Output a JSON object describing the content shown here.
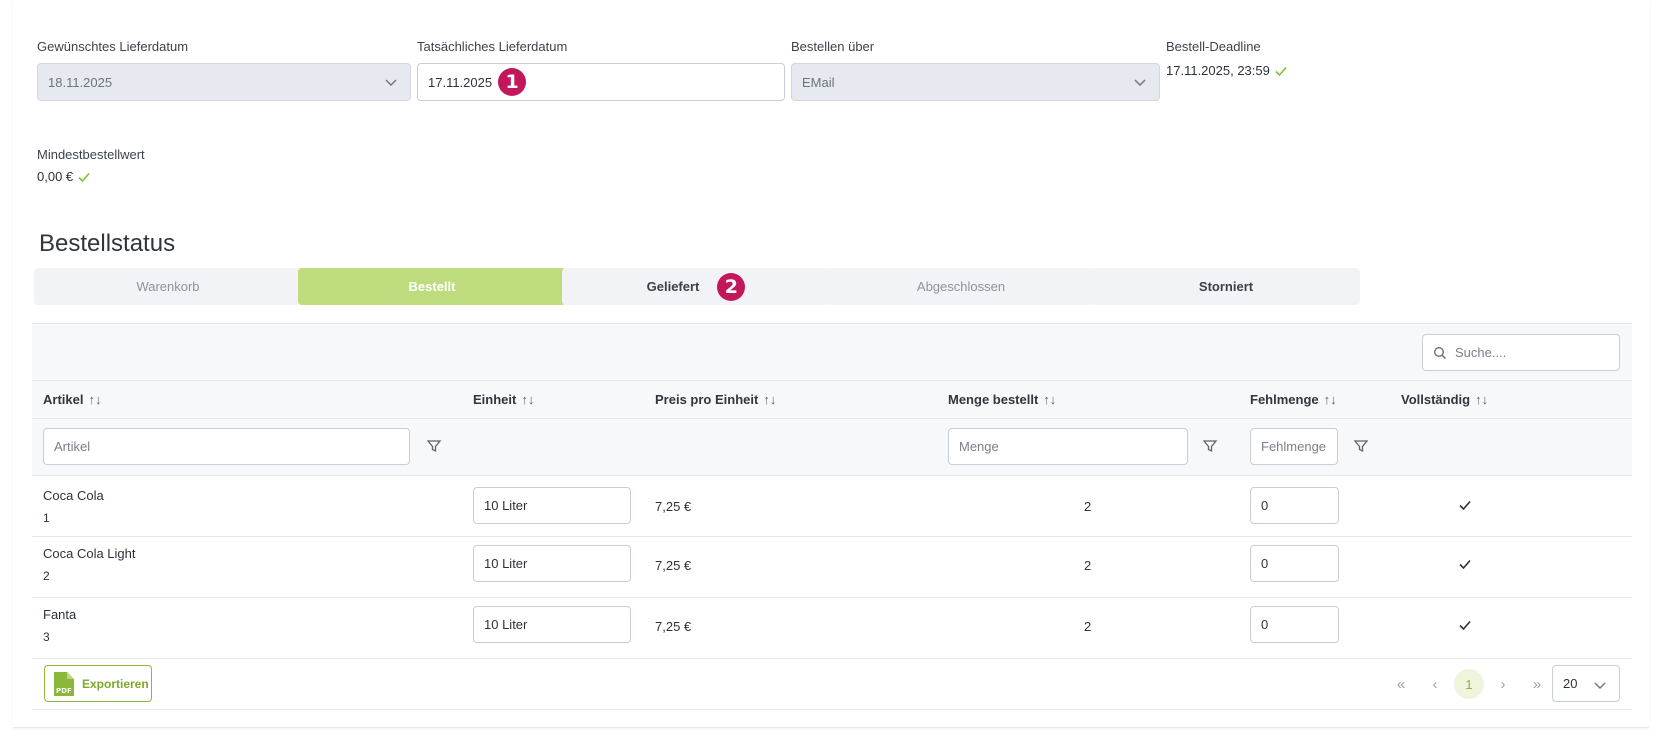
{
  "delivery": {
    "desired_label": "Gewünschtes Lieferdatum",
    "desired_value": "18.11.2025",
    "actual_label": "Tatsächliches Lieferdatum",
    "actual_value": "17.11.2025",
    "actual_badge": "1",
    "order_via_label": "Bestellen über",
    "order_via_value": "EMail",
    "deadline_label": "Bestell-Deadline",
    "deadline_value": "17.11.2025, 23:59",
    "min_label": "Mindestbestellwert",
    "min_value": "0,00 €"
  },
  "status": {
    "title": "Bestellstatus",
    "buttons": [
      {
        "label": "Warenkorb"
      },
      {
        "label": "Bestellt"
      },
      {
        "label": "Geliefert",
        "badge": "2"
      },
      {
        "label": "Abgeschlossen"
      },
      {
        "label": "Storniert"
      }
    ]
  },
  "table": {
    "search_placeholder": "Suche....",
    "sort_icon": "↑↓",
    "columns": [
      "Artikel",
      "Einheit",
      "Preis pro Einheit",
      "Menge bestellt",
      "Fehlmenge",
      "Vollständig"
    ],
    "filters": {
      "artikel_placeholder": "Artikel",
      "menge_placeholder": "Menge",
      "fehlmenge_placeholder": "Fehlmenge"
    },
    "rows": [
      {
        "name": "Coca Cola",
        "id": "1",
        "unit": "10 Liter",
        "price": "7,25 €",
        "qty": "2",
        "missing": "0"
      },
      {
        "name": "Coca Cola Light",
        "id": "2",
        "unit": "10 Liter",
        "price": "7,25 €",
        "qty": "2",
        "missing": "0"
      },
      {
        "name": "Fanta",
        "id": "3",
        "unit": "10 Liter",
        "price": "7,25 €",
        "qty": "2",
        "missing": "0"
      }
    ]
  },
  "footer": {
    "export_label": "Exportieren",
    "pdf_text": "PDF",
    "pager": {
      "first": "«",
      "prev": "‹",
      "current": "1",
      "next": "›",
      "last": "»"
    },
    "page_size": "20"
  },
  "colors": {
    "accent_green": "#bedb7e",
    "badge_magenta": "#c2185b"
  }
}
